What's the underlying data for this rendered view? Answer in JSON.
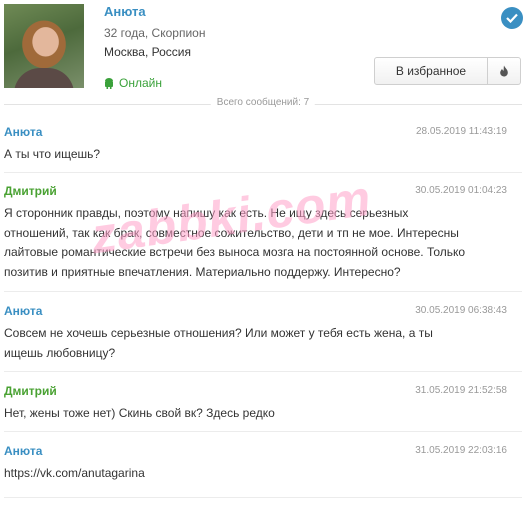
{
  "profile": {
    "name": "Анюта",
    "age_sign": "32 года, Скорпион",
    "city": "Москва, Россия",
    "status": "Онлайн",
    "favorite_label": "В избранное",
    "icons": {
      "verified": "check-circle-icon",
      "online": "android-icon",
      "fire": "fire-icon"
    }
  },
  "total_messages": "Всего сообщений: 7",
  "watermark": "zabbki.com",
  "colors": {
    "female": "#3a8fc2",
    "male": "#4aa233",
    "online": "#3aa13a"
  },
  "messages": [
    {
      "author": "Анюта",
      "date": "28.05.2019 11:43:19",
      "text": "А ты что ищешь?"
    },
    {
      "author": "Дмитрий",
      "date": "30.05.2019 01:04:23",
      "text": "Я сторонник правды, поэтому напишу как есть. Не ищу здесь серьезных отношений, так как брак, совместное сожительство, дети и тп не мое. Интересны лайтовые романтические встречи без выноса мозга на постоянной основе. Только позитив и приятные впечатления. Материально поддержу. Интересно?"
    },
    {
      "author": "Анюта",
      "date": "30.05.2019 06:38:43",
      "text": "Совсем не хочешь серьезные отношения? Или может у тебя есть жена, а ты ищешь любовницу?"
    },
    {
      "author": "Дмитрий",
      "date": "31.05.2019 21:52:58",
      "text": "Нет, жены тоже нет) Скинь свой вк? Здесь редко"
    },
    {
      "author": "Анюта",
      "date": "31.05.2019 22:03:16",
      "text": "https://vk.com/anutagarina"
    }
  ]
}
